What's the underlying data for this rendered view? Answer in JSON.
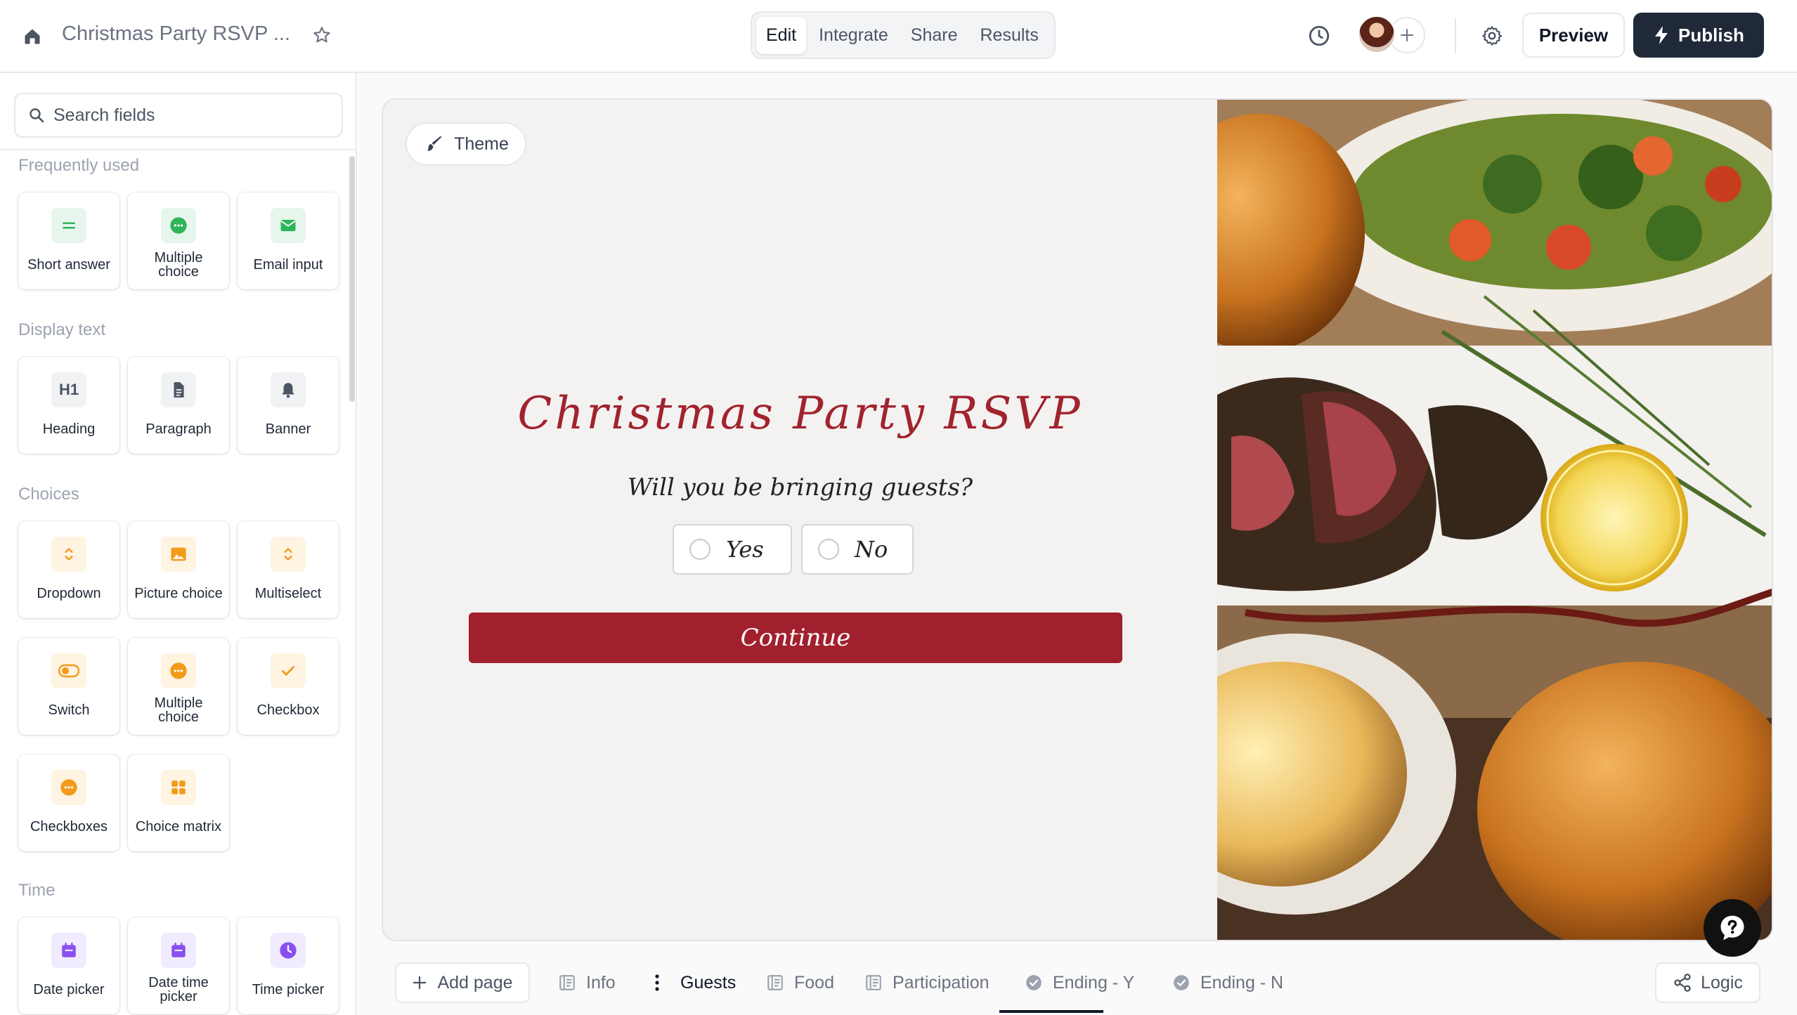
{
  "header": {
    "title": "Christmas Party RSVP ...",
    "tabs": [
      {
        "label": "Edit",
        "active": true
      },
      {
        "label": "Integrate",
        "active": false
      },
      {
        "label": "Share",
        "active": false
      },
      {
        "label": "Results",
        "active": false
      }
    ],
    "preview_label": "Preview",
    "publish_label": "Publish"
  },
  "sidebar": {
    "search_placeholder": "Search fields",
    "sections": [
      {
        "title": "Frequently used",
        "items": [
          {
            "label": "Short answer",
            "icon": "equals-icon"
          },
          {
            "label": "Multiple choice",
            "icon": "dots-circle-icon"
          },
          {
            "label": "Email input",
            "icon": "envelope-icon"
          }
        ]
      },
      {
        "title": "Display text",
        "items": [
          {
            "label": "Heading",
            "icon": "h1-icon"
          },
          {
            "label": "Paragraph",
            "icon": "document-icon"
          },
          {
            "label": "Banner",
            "icon": "bell-icon"
          }
        ]
      },
      {
        "title": "Choices",
        "items": [
          {
            "label": "Dropdown",
            "icon": "chevron-updown-icon"
          },
          {
            "label": "Picture choice",
            "icon": "image-icon"
          },
          {
            "label": "Multiselect",
            "icon": "chevron-updown-icon"
          },
          {
            "label": "Switch",
            "icon": "toggle-icon"
          },
          {
            "label": "Multiple choice",
            "icon": "dots-circle-icon"
          },
          {
            "label": "Checkbox",
            "icon": "check-icon"
          },
          {
            "label": "Checkboxes",
            "icon": "dots-circle-icon"
          },
          {
            "label": "Choice matrix",
            "icon": "grid-icon"
          }
        ]
      },
      {
        "title": "Time",
        "items": [
          {
            "label": "Date picker",
            "icon": "calendar-icon"
          },
          {
            "label": "Date time picker",
            "icon": "calendar-icon"
          },
          {
            "label": "Time picker",
            "icon": "clock-icon"
          }
        ]
      }
    ]
  },
  "canvas": {
    "theme_label": "Theme",
    "heading": "Christmas Party RSVP",
    "question": "Will you be bringing guests?",
    "options": [
      "Yes",
      "No"
    ],
    "continue_label": "Continue"
  },
  "pagebar": {
    "add_page_label": "Add page",
    "pages": [
      {
        "label": "Info",
        "icon": "page-icon",
        "active": false
      },
      {
        "label": "Guests",
        "icon": "more-vertical-icon",
        "active": true
      },
      {
        "label": "Food",
        "icon": "page-icon",
        "active": false
      },
      {
        "label": "Participation",
        "icon": "page-icon",
        "active": false
      },
      {
        "label": "Ending - Y",
        "icon": "check-circle-icon",
        "active": false
      },
      {
        "label": "Ending - N",
        "icon": "check-circle-icon",
        "active": false
      }
    ],
    "logic_label": "Logic"
  },
  "colors": {
    "brand_red": "#a1202e",
    "publish_bg": "#1f2937",
    "canvas_bg": "#f3f2f1"
  }
}
